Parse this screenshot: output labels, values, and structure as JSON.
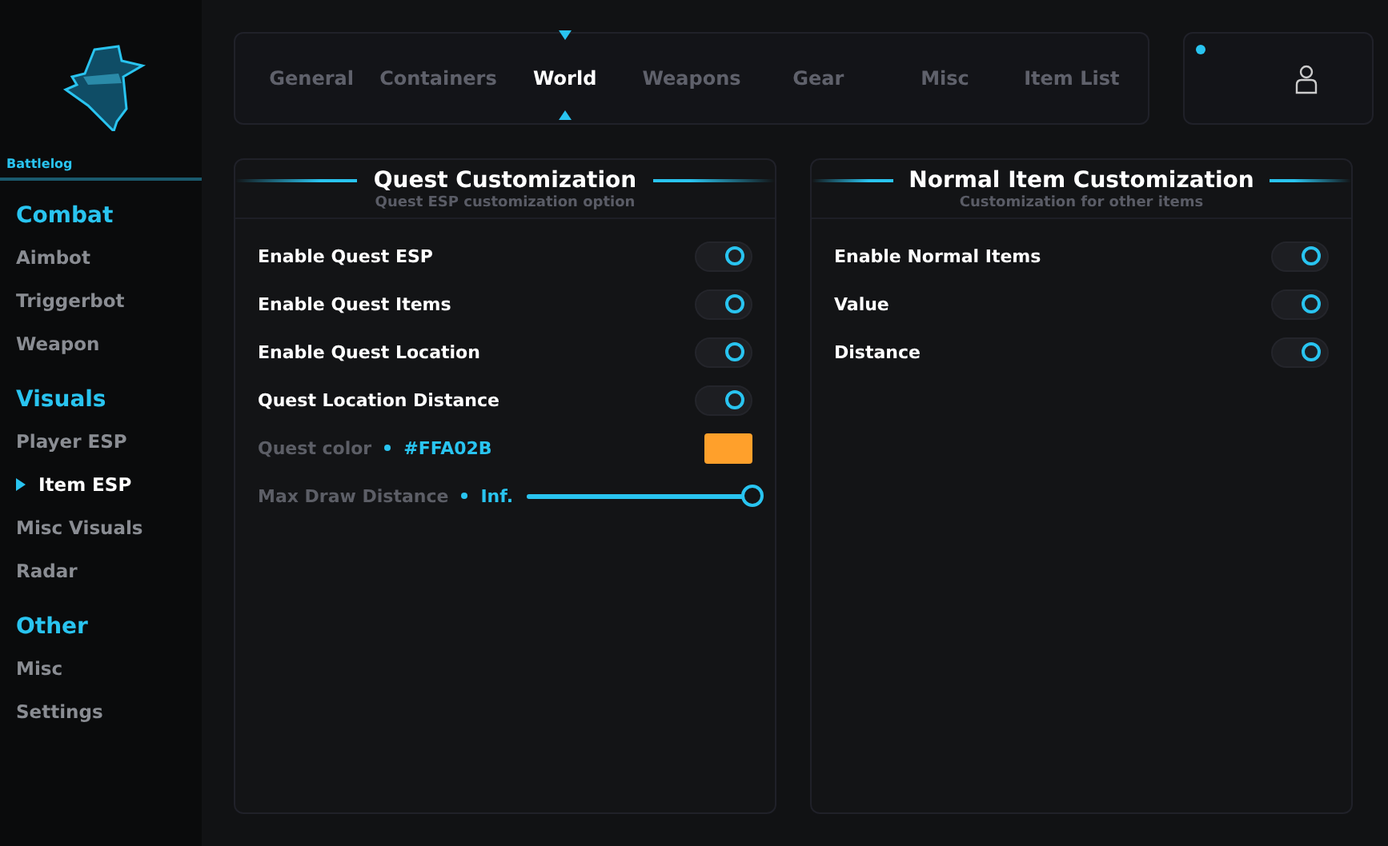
{
  "sidebar": {
    "brand": "Battlelog",
    "sections": [
      {
        "title": "Combat",
        "items": [
          {
            "label": "Aimbot",
            "selected": false
          },
          {
            "label": "Triggerbot",
            "selected": false
          },
          {
            "label": "Weapon",
            "selected": false
          }
        ]
      },
      {
        "title": "Visuals",
        "items": [
          {
            "label": "Player ESP",
            "selected": false
          },
          {
            "label": "Item ESP",
            "selected": true
          },
          {
            "label": "Misc Visuals",
            "selected": false
          },
          {
            "label": "Radar",
            "selected": false
          }
        ]
      },
      {
        "title": "Other",
        "items": [
          {
            "label": "Misc",
            "selected": false
          },
          {
            "label": "Settings",
            "selected": false
          }
        ]
      }
    ]
  },
  "tabs": [
    {
      "label": "General",
      "selected": false
    },
    {
      "label": "Containers",
      "selected": false
    },
    {
      "label": "World",
      "selected": true
    },
    {
      "label": "Weapons",
      "selected": false
    },
    {
      "label": "Gear",
      "selected": false
    },
    {
      "label": "Misc",
      "selected": false
    },
    {
      "label": "Item List",
      "selected": false
    }
  ],
  "panels": [
    {
      "title": "Quest Customization",
      "subtitle": "Quest ESP customization option",
      "rows": [
        {
          "kind": "toggle",
          "label": "Enable Quest ESP",
          "on": true
        },
        {
          "kind": "toggle",
          "label": "Enable Quest Items",
          "on": true
        },
        {
          "kind": "toggle",
          "label": "Enable Quest Location",
          "on": true
        },
        {
          "kind": "toggle",
          "label": "Quest Location Distance",
          "on": true
        },
        {
          "kind": "color",
          "label": "Quest color",
          "reading": "#FFA02B",
          "color": "#ffa02b"
        },
        {
          "kind": "slider",
          "label": "Max Draw Distance",
          "reading": "Inf.",
          "level": 1
        }
      ]
    },
    {
      "title": "Normal Item Customization",
      "subtitle": "Customization for other items",
      "rows": [
        {
          "kind": "toggle",
          "label": "Enable Normal Items",
          "on": true
        },
        {
          "kind": "toggle",
          "label": "Value",
          "on": true
        },
        {
          "kind": "toggle",
          "label": "Distance",
          "on": true
        }
      ]
    }
  ]
}
